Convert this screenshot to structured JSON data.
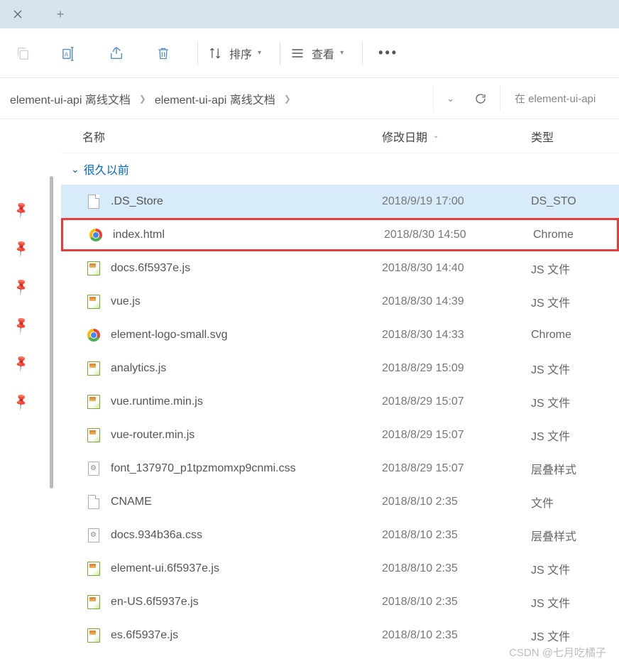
{
  "tabs": {
    "add": "+"
  },
  "toolbar": {
    "sort_label": "排序",
    "view_label": "查看"
  },
  "breadcrumbs": [
    "element-ui-api 离线文档",
    "element-ui-api 离线文档"
  ],
  "search_placeholder": "在 element-ui-api",
  "columns": {
    "name": "名称",
    "date": "修改日期",
    "type": "类型"
  },
  "group_header": "很久以前",
  "files": [
    {
      "name": ".DS_Store",
      "date": "2018/9/19 17:00",
      "type": "DS_STO",
      "icon": "file",
      "selected": true
    },
    {
      "name": "index.html",
      "date": "2018/8/30 14:50",
      "type": "Chrome",
      "icon": "chrome",
      "highlighted": true
    },
    {
      "name": "docs.6f5937e.js",
      "date": "2018/8/30 14:40",
      "type": "JS 文件",
      "icon": "js"
    },
    {
      "name": "vue.js",
      "date": "2018/8/30 14:39",
      "type": "JS 文件",
      "icon": "js"
    },
    {
      "name": "element-logo-small.svg",
      "date": "2018/8/30 14:33",
      "type": "Chrome",
      "icon": "chrome"
    },
    {
      "name": "analytics.js",
      "date": "2018/8/29 15:09",
      "type": "JS 文件",
      "icon": "js"
    },
    {
      "name": "vue.runtime.min.js",
      "date": "2018/8/29 15:07",
      "type": "JS 文件",
      "icon": "js"
    },
    {
      "name": "vue-router.min.js",
      "date": "2018/8/29 15:07",
      "type": "JS 文件",
      "icon": "js"
    },
    {
      "name": "font_137970_p1tpzmomxp9cnmi.css",
      "date": "2018/8/29 15:07",
      "type": "层叠样式",
      "icon": "gear"
    },
    {
      "name": "CNAME",
      "date": "2018/8/10 2:35",
      "type": "文件",
      "icon": "file"
    },
    {
      "name": "docs.934b36a.css",
      "date": "2018/8/10 2:35",
      "type": "层叠样式",
      "icon": "gear"
    },
    {
      "name": "element-ui.6f5937e.js",
      "date": "2018/8/10 2:35",
      "type": "JS 文件",
      "icon": "js"
    },
    {
      "name": "en-US.6f5937e.js",
      "date": "2018/8/10 2:35",
      "type": "JS 文件",
      "icon": "js"
    },
    {
      "name": "es.6f5937e.js",
      "date": "2018/8/10 2:35",
      "type": "JS 文件",
      "icon": "js"
    }
  ],
  "watermark": "CSDN @七月吃橘子"
}
